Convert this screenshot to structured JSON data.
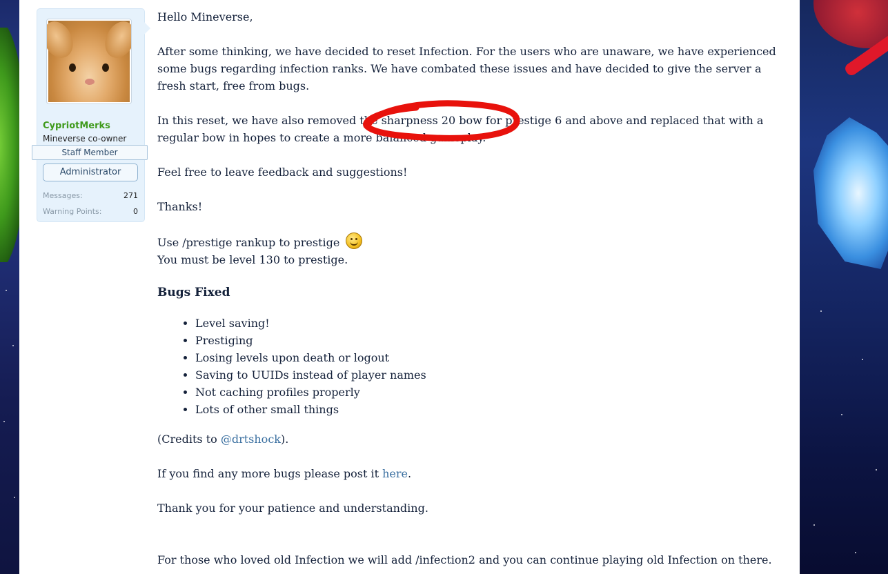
{
  "user": {
    "name": "CypriotMerks",
    "title": "Mineverse co-owner",
    "banner": "Staff Member",
    "badge": "Administrator",
    "stats": [
      {
        "label": "Messages:",
        "value": "271"
      },
      {
        "label": "Warning Points:",
        "value": "0"
      }
    ]
  },
  "post": {
    "greeting": "Hello Mineverse,",
    "p1": "After some thinking, we have decided to reset Infection. For the users who are unaware, we have experienced some bugs regarding infection ranks. We have combated these issues and have decided to give the server a fresh start, free from bugs.",
    "p2": "In this reset, we have also removed the sharpness 20 bow for prestige 6 and above and replaced that with a regular bow in hopes to create a more balanced gameplay.",
    "p3": "Feel free to leave feedback and suggestions!",
    "p4": "Thanks!",
    "p5_line1": "Use /prestige rankup to prestige",
    "p5_line2": "You must be level 130 to prestige.",
    "bugs_heading": "Bugs Fixed",
    "bugs": [
      "Level saving!",
      "Prestiging",
      "Losing levels upon death or logout",
      "Saving to UUIDs instead of player names",
      "Not caching profiles properly",
      "Lots of other small things"
    ],
    "credits_prefix": "(Credits to ",
    "credits_link": "@drtshock",
    "credits_suffix": ").",
    "bugs_prefix": "If you find any more bugs please post it ",
    "bugs_link": "here",
    "bugs_suffix": ".",
    "thanks": "Thank you for your patience and understanding.",
    "closing": "For those who loved old Infection we will add /infection2 and you can continue playing old Infection on there."
  },
  "colors": {
    "username": "#3f9a1c",
    "link": "#3a6fa0",
    "annotation": "#e8120c"
  }
}
